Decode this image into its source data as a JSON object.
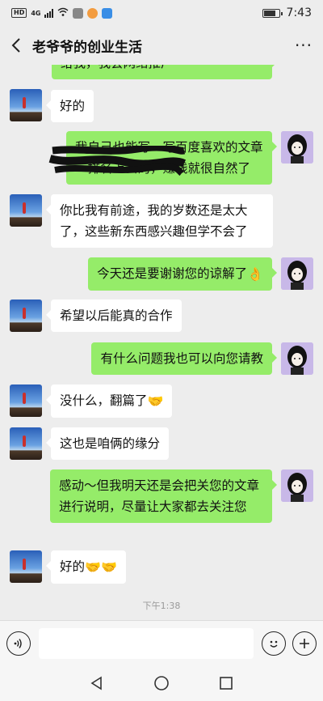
{
  "status_bar": {
    "network_badge": "HD",
    "network_type": "4G",
    "time": "7:43",
    "icons": [
      "signal-icon",
      "wifi-icon",
      "notification-icons",
      "battery-icon"
    ]
  },
  "header": {
    "back_icon": "chevron-left-icon",
    "title": "老爷爷的创业生活",
    "more_icon": "more-dots-icon",
    "more_glyph": "···"
  },
  "messages": [
    {
      "side": "out",
      "text": "给我，我会网络推广"
    },
    {
      "side": "in",
      "text": "好的"
    },
    {
      "side": "out",
      "text": "我自己也能写一写百度喜欢的文章～排名上去的，赚钱就很自然了",
      "redacted": true
    },
    {
      "side": "in",
      "text": "你比我有前途，我的岁数还是太大了，这些新东西感兴趣但学不会了"
    },
    {
      "side": "out",
      "text": "今天还是要谢谢您的谅解了",
      "emoji": "👌"
    },
    {
      "side": "in",
      "text": "希望以后能真的合作"
    },
    {
      "side": "out",
      "text": "有什么问题我也可以向您请教"
    },
    {
      "side": "in",
      "text": "没什么，翻篇了",
      "emoji": "🤝"
    },
    {
      "side": "in",
      "text": "这也是咱俩的缘分"
    },
    {
      "side": "out",
      "text": "感动～但我明天还是会把关您的文章进行说明，尽量让大家都去关注您"
    },
    {
      "side": "in",
      "text": "好的",
      "emoji": "🤝🤝"
    }
  ],
  "timestamp": "下午1:38",
  "input_bar": {
    "voice_icon": "voice-icon",
    "emoji_icon": "emoji-icon",
    "add_icon": "plus-icon",
    "input_value": ""
  },
  "nav_bar": {
    "back_icon": "nav-back-icon",
    "home_icon": "nav-home-icon",
    "recent_icon": "nav-recent-icon"
  },
  "colors": {
    "background": "#ededed",
    "outgoing_bubble": "#95ec69",
    "incoming_bubble": "#ffffff",
    "timestamp": "#9a9a9a"
  }
}
